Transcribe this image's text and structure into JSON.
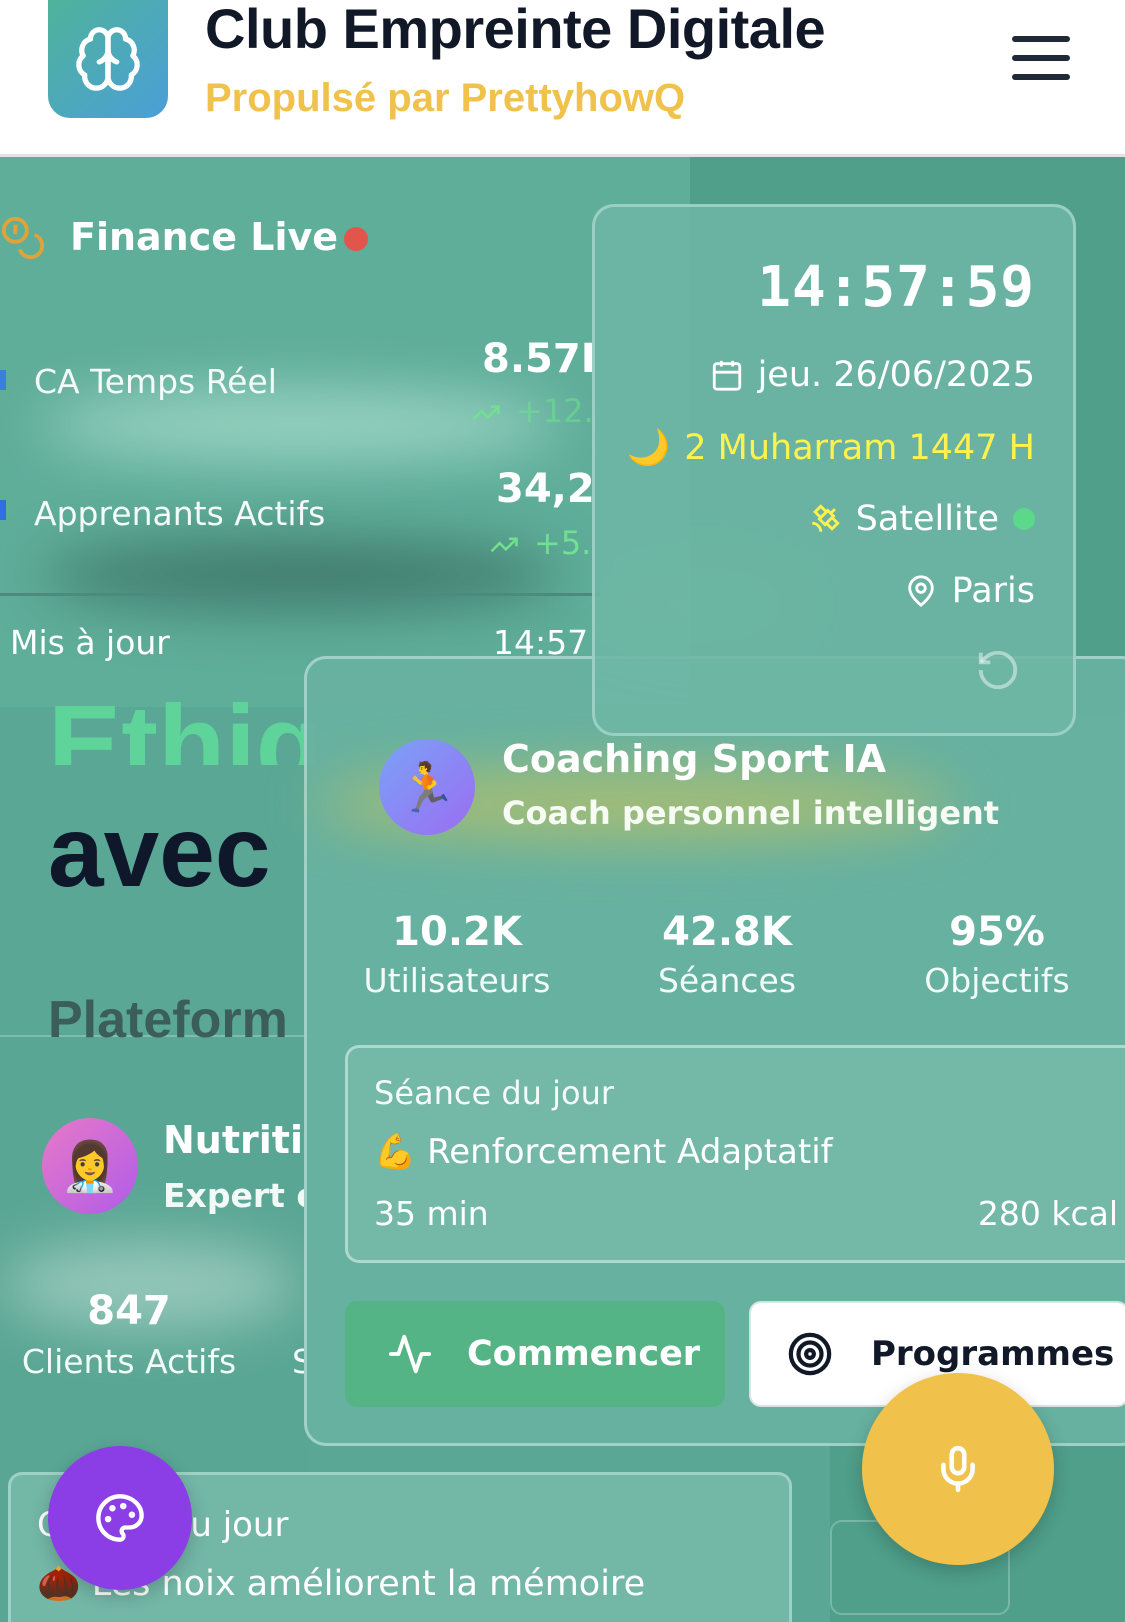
{
  "header": {
    "title": "Club Empreinte Digitale",
    "subtitle": "Propulsé par PrettyhowQ",
    "logo_icon": "brain-icon",
    "menu_icon": "hamburger-menu-icon"
  },
  "hero": {
    "line1": "Ethiq",
    "line2": "avec",
    "line3": "Plateform"
  },
  "finance": {
    "title": "Finance Live",
    "live_status_color": "#e2554d",
    "metrics": [
      {
        "label": "CA Temps Réel",
        "value": "8.57I",
        "trend": "+12."
      },
      {
        "label": "Apprenants Actifs",
        "value": "34,2",
        "trend": "+5."
      }
    ],
    "updated_label": "Mis à jour",
    "updated_time": "14:57"
  },
  "clock": {
    "time": "14:57:59",
    "date": "jeu. 26/06/2025",
    "hijri": "2 Muharram 1447 H",
    "satellite": "Satellite",
    "location": "Paris",
    "hijri_emoji": "🌙"
  },
  "coaching": {
    "avatar_emoji": "🏃",
    "title": "Coaching Sport IA",
    "subtitle": "Coach personnel intelligent",
    "stats": [
      {
        "value": "10.2K",
        "label": "Utilisateurs"
      },
      {
        "value": "42.8K",
        "label": "Séances"
      },
      {
        "value": "95%",
        "label": "Objectifs"
      }
    ],
    "session": {
      "label": "Séance du jour",
      "emoji": "💪",
      "name": "Renforcement Adaptatif",
      "duration": "35 min",
      "calories": "280 kcal"
    },
    "start_label": "Commencer",
    "programs_label": "Programmes"
  },
  "nutrition": {
    "avatar_emoji": "👩‍⚕️",
    "title": "Nutritio",
    "subtitle": "Expert e",
    "stat_value": "847",
    "stat_label": "Clients Actifs",
    "stat2_label_partial": "S"
  },
  "tip": {
    "title": "C",
    "title_rest": "du jour",
    "emoji": "🌰",
    "text": "Les noix améliorent la mémoire"
  },
  "colors": {
    "accent_yellow": "#f0c24b",
    "accent_purple": "#8b3ee6",
    "accent_green": "#55b485"
  }
}
